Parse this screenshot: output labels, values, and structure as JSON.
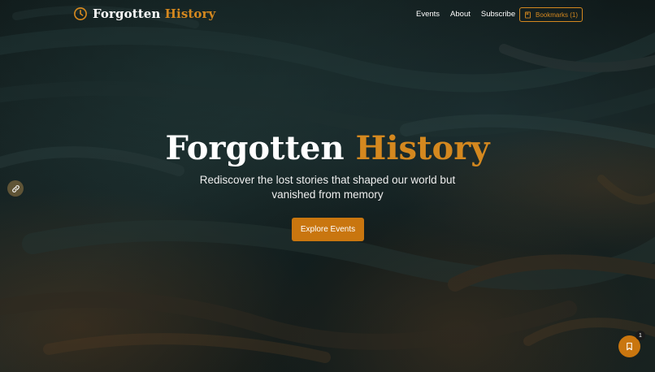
{
  "brand": {
    "word1": "Forgotten",
    "word2": "History",
    "icon": "clock-icon"
  },
  "nav": {
    "links": [
      "Events",
      "About",
      "Subscribe"
    ],
    "bookmarks_label": "Bookmarks (1)",
    "bookmarks_icon": "book-icon"
  },
  "hero": {
    "title_word1": "Forgotten",
    "title_word2": "History",
    "subtitle": "Rediscover the lost stories that shaped our world but vanished from memory",
    "cta_label": "Explore Events"
  },
  "side_link": {
    "icon": "link-icon"
  },
  "fab": {
    "icon": "bookmark-icon",
    "badge_count": "1"
  },
  "colors": {
    "accent": "#d4881f",
    "button": "#c9760f",
    "text": "#ffffff"
  }
}
